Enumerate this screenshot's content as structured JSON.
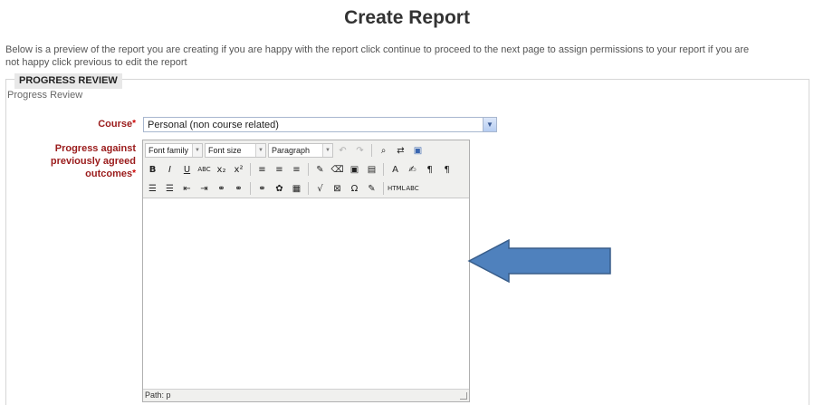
{
  "page": {
    "title": "Create Report",
    "intro_line1": "Below is a preview of the report you are creating if you are happy with the report click continue to proceed to the next page to assign permissions to your report if you are",
    "intro_line2": "not happy click previous to edit the report"
  },
  "section": {
    "legend": "PROGRESS REVIEW",
    "subtitle": "Progress Review"
  },
  "form": {
    "course_label": "Course",
    "course_value": "Personal (non course related)",
    "required_marker": "*",
    "progress_label_line1": "Progress against",
    "progress_label_line2": "previously agreed",
    "progress_label_line3": "outcomes"
  },
  "editor": {
    "font_family": "Font family",
    "font_size": "Font size",
    "format": "Paragraph",
    "path_label": "Path: p",
    "toolbar_row2": [
      "B",
      "I",
      "U",
      "ABC",
      "x₂",
      "x²",
      "≡",
      "≡",
      "≡",
      "✎",
      "⌫",
      "▣",
      "▤",
      "A",
      "✍",
      "¶",
      "¶"
    ],
    "toolbar_row3": [
      "☰",
      "☰",
      "⇤",
      "⇥",
      "⚭",
      "⚭",
      "⚭",
      "✿",
      "▦",
      "√",
      "⊠",
      "Ω",
      "✎",
      "HTML",
      "ABC"
    ]
  },
  "colors": {
    "label_red": "#9a1b1b",
    "arrow_blue": "#4f81bd"
  }
}
